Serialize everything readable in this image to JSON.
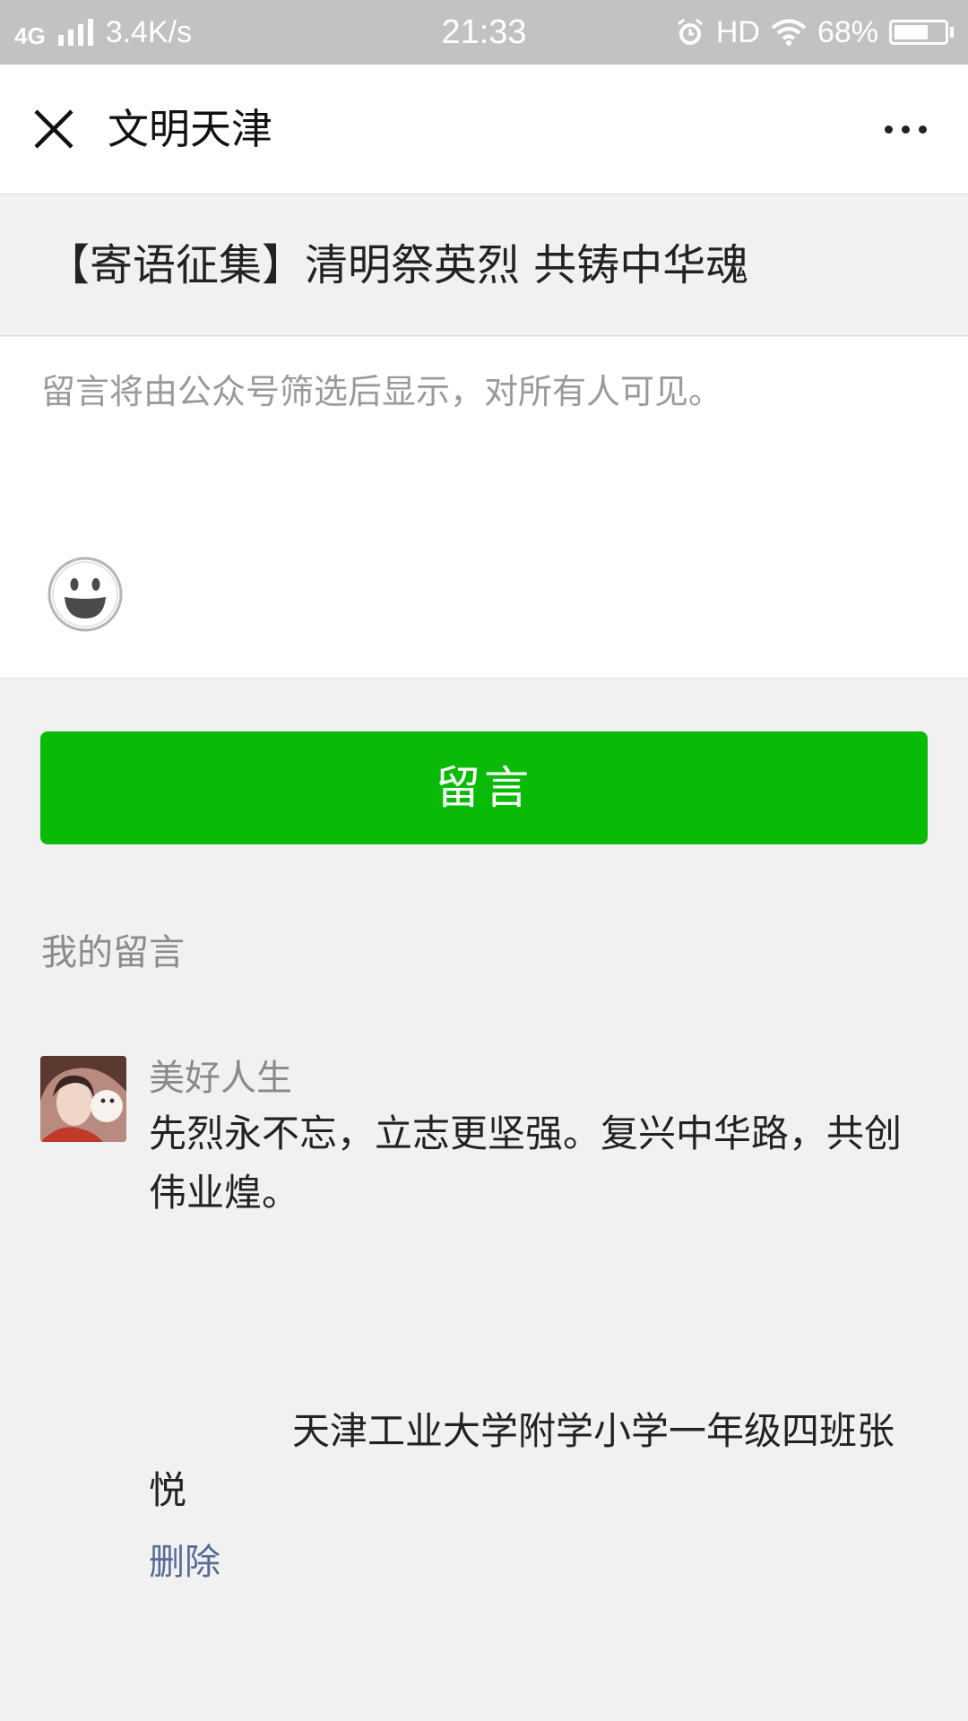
{
  "status_bar": {
    "network": "4G",
    "speed": "3.4K/s",
    "time": "21:33",
    "hd": "HD",
    "battery": "68%",
    "battery_level": 0.68
  },
  "title_bar": {
    "title": "文明天津"
  },
  "article": {
    "title": "【寄语征集】清明祭英烈 共铸中华魂"
  },
  "comment_input": {
    "placeholder": "留言将由公众号筛选后显示，对所有人可见。"
  },
  "submit_button": {
    "label": "留言",
    "color": "#09bb07"
  },
  "my_comments": {
    "section_label": "我的留言",
    "items": [
      {
        "author": "美好人生",
        "text": "先烈永不忘，立志更坚强。复兴中华路，共创伟业煌。",
        "signature": "天津工业大学附学小学一年级四班张悦",
        "delete_label": "删除"
      }
    ]
  },
  "colors": {
    "status_bar": "#c2c2c2",
    "background": "#f1f1f1",
    "link": "#576b95"
  }
}
